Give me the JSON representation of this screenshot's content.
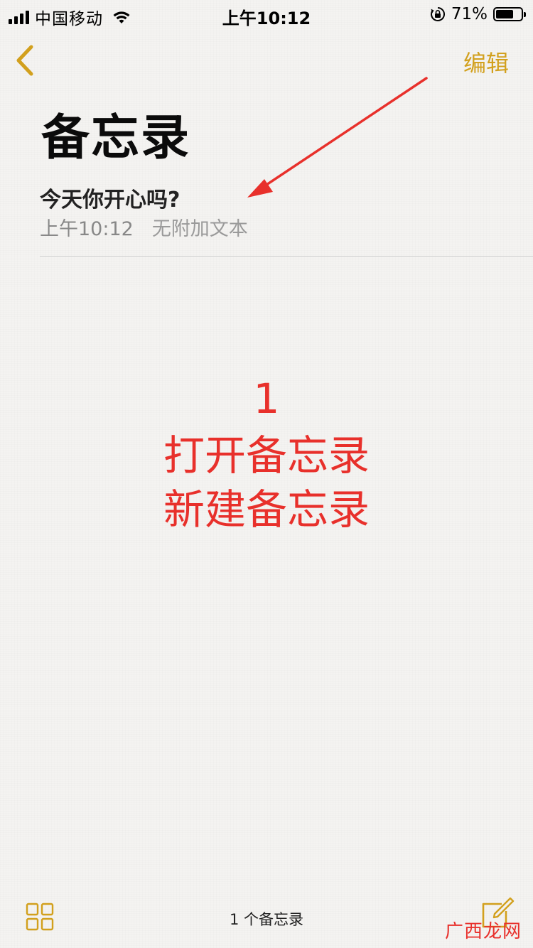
{
  "status_bar": {
    "carrier": "中国移动",
    "time": "上午10:12",
    "battery_percent": "71%",
    "battery_level": 0.71,
    "icons": [
      "signal-icon",
      "wifi-icon",
      "orientation-lock-icon",
      "battery-icon"
    ]
  },
  "nav": {
    "back_icon": "chevron-left-icon",
    "edit_label": "编辑"
  },
  "page_title": "备忘录",
  "notes": [
    {
      "title": "今天你开心吗?",
      "time": "上午10:12",
      "preview": "无附加文本"
    }
  ],
  "annotation": {
    "step": "1",
    "line1": "打开备忘录",
    "line2": "新建备忘录"
  },
  "toolbar": {
    "grid_icon": "grid-view-icon",
    "note_count": "1 个备忘录",
    "compose_icon": "compose-icon"
  },
  "watermark": "广西龙网",
  "colors": {
    "accent": "#d2a01d",
    "annotation": "#e8302b",
    "background": "#f4f3f1"
  }
}
